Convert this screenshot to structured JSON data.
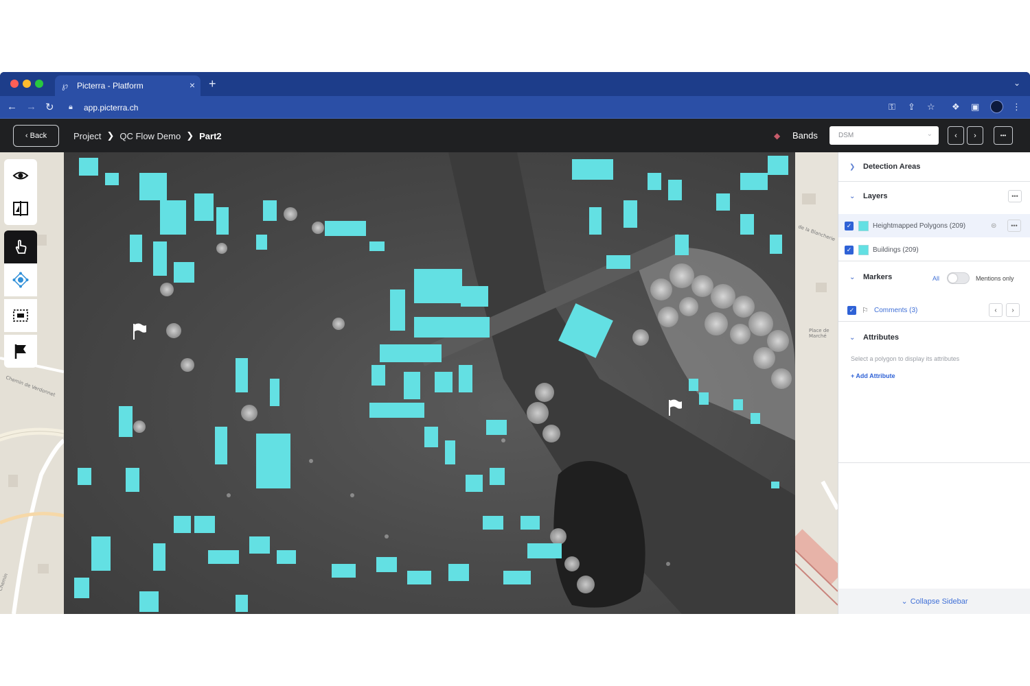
{
  "browser": {
    "tab_title": "Picterra - Platform",
    "url": "app.picterra.ch",
    "tab_close": "×",
    "new_tab": "+"
  },
  "app_header": {
    "back_label": "‹ Back",
    "breadcrumb": [
      "Project",
      "QC Flow Demo",
      "Part2"
    ],
    "bands_label": "Bands",
    "bands_value": "DSM",
    "prev": "‹",
    "next": "›",
    "more": "•••"
  },
  "tools": [
    {
      "name": "visibility",
      "icon": "eye-icon"
    },
    {
      "name": "compare",
      "icon": "split-view-icon"
    },
    {
      "name": "pan",
      "icon": "hand-pointer-icon",
      "active": true
    },
    {
      "name": "edit-vertices",
      "icon": "vertex-edit-icon"
    },
    {
      "name": "select-area",
      "icon": "selection-box-icon"
    },
    {
      "name": "marker",
      "icon": "flag-icon"
    }
  ],
  "sidebar": {
    "detection_areas": "Detection Areas",
    "layers_title": "Layers",
    "layers": [
      {
        "label": "Heightmapped Polygons (209)",
        "color": "#63e0e3"
      },
      {
        "label": "Buildings (209)",
        "color": "#63e0e3"
      }
    ],
    "markers_title": "Markers",
    "markers_all": "All",
    "markers_mentions": "Mentions only",
    "comments_label": "Comments (3)",
    "attributes_title": "Attributes",
    "attributes_hint": "Select a polygon to display its attributes",
    "add_attribute": "+ Add Attribute",
    "collapse": "Collapse Sidebar"
  },
  "colors": {
    "polygon": "#63e0e3",
    "tab_bar": "#1d3d8a",
    "accent": "#2f62d6"
  }
}
